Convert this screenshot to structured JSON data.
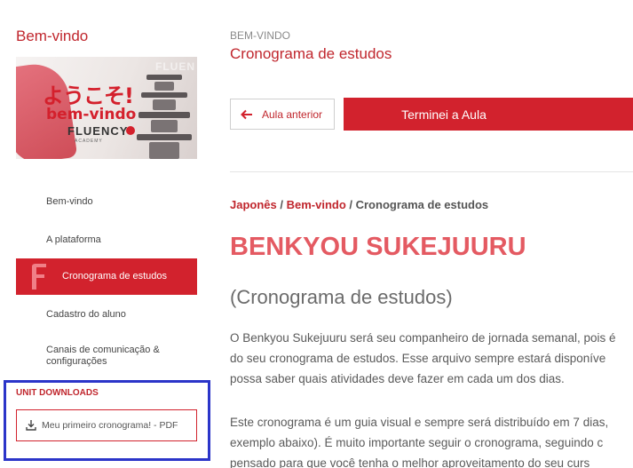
{
  "sidebar": {
    "title": "Bem-vindo",
    "banner": {
      "japanese": "ようこそ!",
      "welcome": "bem-vindo",
      "brand": "FLUENCY",
      "brand_sub": "ACADEMY",
      "ghost": "FLUEN"
    },
    "items": [
      {
        "label": "Bem-vindo"
      },
      {
        "label": "A plataforma"
      },
      {
        "label": "Cronograma de estudos",
        "active": true
      },
      {
        "label": "Cadastro do aluno"
      },
      {
        "label": "Canais de comunicação & configurações"
      }
    ],
    "downloads": {
      "title": "UNIT DOWNLOADS",
      "file_label": "Meu primeiro cronograma! - PDF"
    }
  },
  "header": {
    "section": "BEM-VINDO",
    "title": "Cronograma de estudos",
    "prev_label": "Aula anterior",
    "done_label": "Terminei a Aula"
  },
  "content": {
    "breadcrumb": {
      "course": "Japonês",
      "separator": " / ",
      "module": "Bem-vindo",
      "current": "Cronograma de estudos"
    },
    "heading": "BENKYOU SUKEJUURU",
    "subheading": "(Cronograma de estudos)",
    "paragraph1": [
      "O Benkyou Sukejuuru será seu companheiro de jornada semanal, pois é",
      "do seu cronograma de estudos. Esse arquivo sempre estará disponíve",
      "possa saber quais atividades deve fazer em cada um dos dias."
    ],
    "paragraph2": [
      "Este cronograma é um guia visual e sempre será distribuído em 7 dias,",
      "exemplo abaixo). É muito importante seguir o cronograma, seguindo c",
      "pensado para que você tenha o melhor aproveitamento do seu curs"
    ]
  },
  "colors": {
    "accent": "#d2222d",
    "highlight_box": "#2b35c9"
  }
}
